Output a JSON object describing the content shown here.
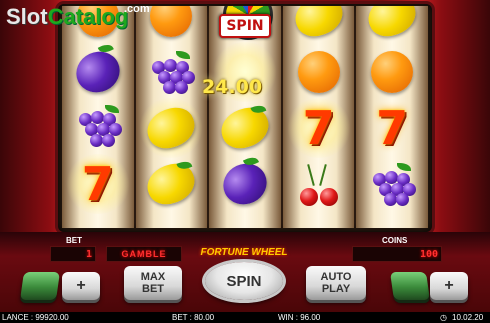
{
  "logo": {
    "part1": "Slot",
    "part2": "Catalog",
    "suffix": ".com"
  },
  "reels": [
    [
      "orange",
      "plum",
      "grapes",
      "seven-glow"
    ],
    [
      "orange",
      "grapes",
      "lemon-glow",
      "lemon"
    ],
    [
      "spin",
      "wheel-win",
      "lemon",
      "plum"
    ],
    [
      "lemon",
      "orange",
      "seven-glow",
      "cherries"
    ],
    [
      "lemon",
      "orange",
      "seven",
      "grapes"
    ]
  ],
  "spin_symbol_label": "SPIN",
  "win_amount": "24.00",
  "labels": {
    "bet": "BET",
    "coins": "COINS"
  },
  "displays": {
    "bet_value": "1",
    "gamble": "GAMBLE",
    "coins_value": "100"
  },
  "fortune_wheel_title": "FORTUNE WHEEL",
  "buttons": {
    "minus": "-",
    "plus": "+",
    "max_bet_line1": "MAX",
    "max_bet_line2": "BET",
    "spin": "SPIN",
    "auto_line1": "AUTO",
    "auto_line2": "PLAY"
  },
  "status_bar": {
    "balance": "LANCE : 99920.00",
    "bet": "BET : 80.00",
    "win": "WIN : 96.00",
    "time": "10.02.20"
  },
  "colors": {
    "cabinet_red": "#c01d20",
    "lcd_red": "#ff3030",
    "win_yellow": "#ffe84a"
  }
}
